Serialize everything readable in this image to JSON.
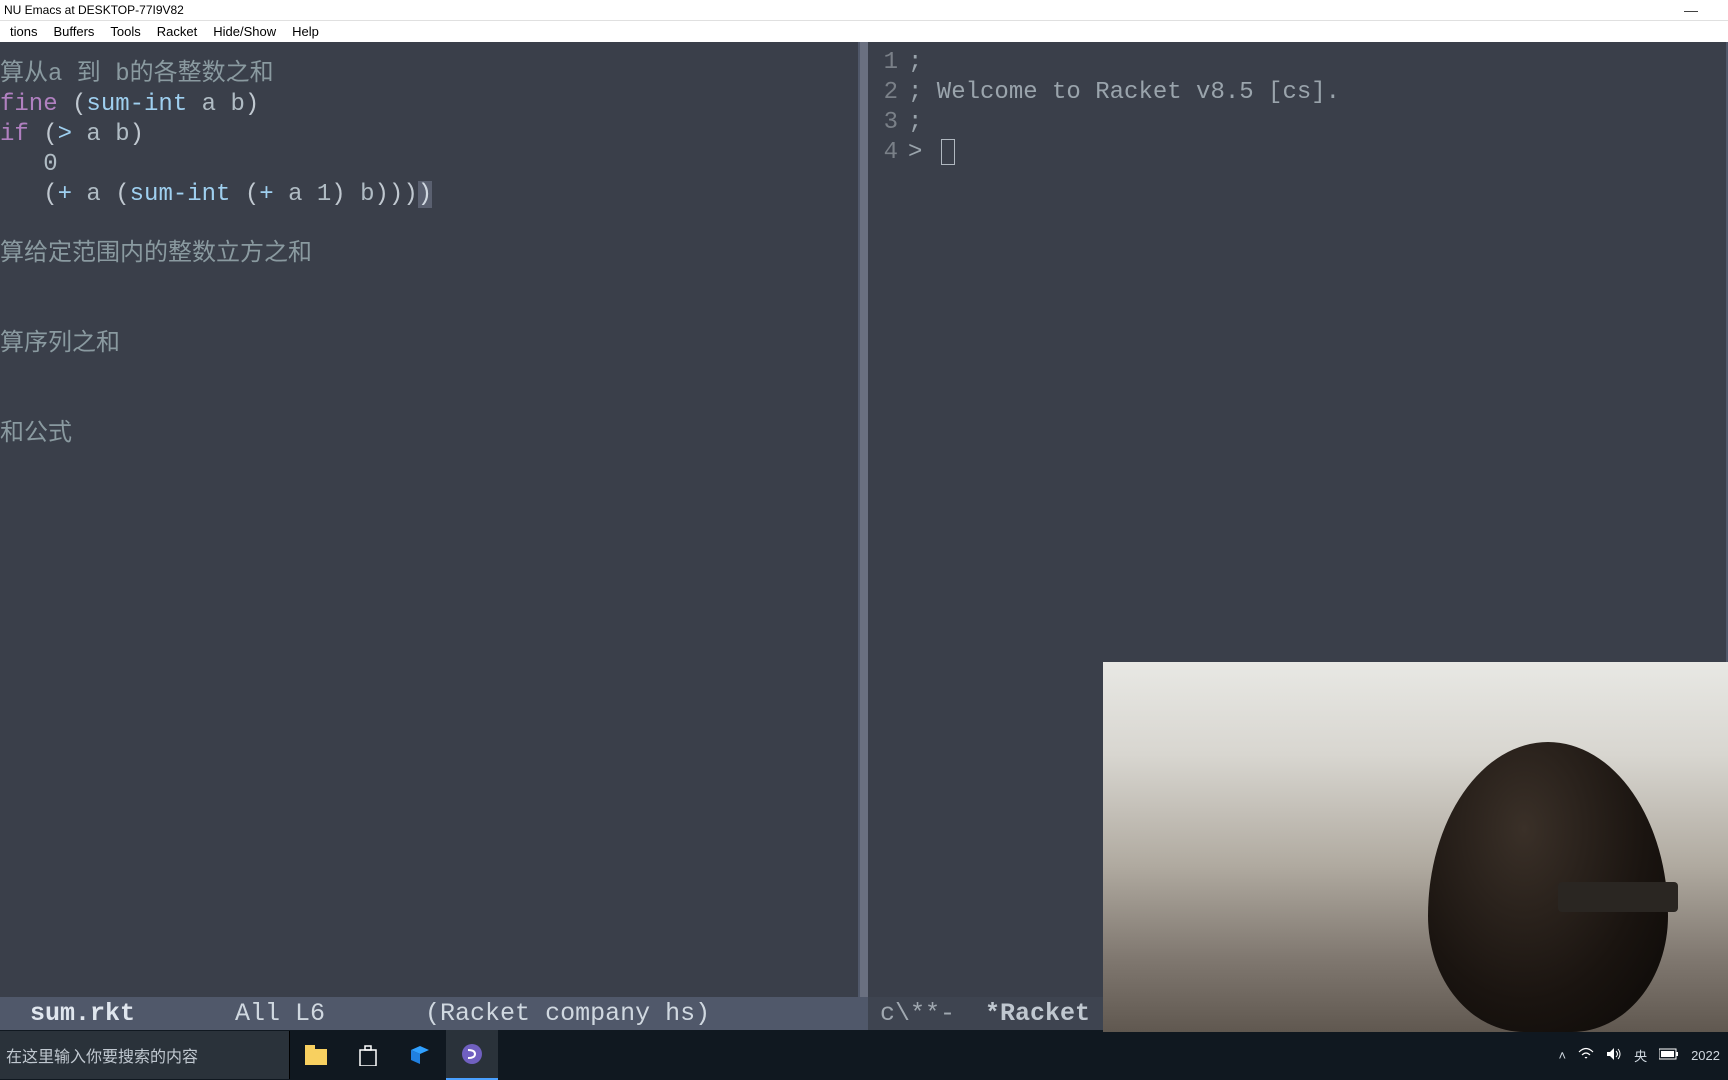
{
  "window": {
    "title": "NU Emacs at DESKTOP-77I9V82"
  },
  "menubar": [
    "tions",
    "Buffers",
    "Tools",
    "Racket",
    "Hide/Show",
    "Help"
  ],
  "editor_left": {
    "lines": [
      {
        "type": "comment",
        "text": "算从a 到 b的各整数之和"
      },
      {
        "type": "code",
        "segments": [
          {
            "c": "keyword",
            "t": "fine"
          },
          {
            "c": "paren",
            "t": " ("
          },
          {
            "c": "func",
            "t": "sum-int"
          },
          {
            "c": "text",
            "t": " a b"
          },
          {
            "c": "paren",
            "t": ")"
          }
        ]
      },
      {
        "type": "code",
        "segments": [
          {
            "c": "keyword",
            "t": "if"
          },
          {
            "c": "paren",
            "t": " ("
          },
          {
            "c": "func",
            "t": ">"
          },
          {
            "c": "text",
            "t": " a b"
          },
          {
            "c": "paren",
            "t": ")"
          }
        ]
      },
      {
        "type": "code",
        "segments": [
          {
            "c": "text",
            "t": "   0"
          }
        ]
      },
      {
        "type": "code",
        "segments": [
          {
            "c": "paren",
            "t": "   ("
          },
          {
            "c": "func",
            "t": "+"
          },
          {
            "c": "text",
            "t": " a "
          },
          {
            "c": "paren",
            "t": "("
          },
          {
            "c": "func",
            "t": "sum-int"
          },
          {
            "c": "paren",
            "t": " ("
          },
          {
            "c": "func",
            "t": "+"
          },
          {
            "c": "text",
            "t": " a 1"
          },
          {
            "c": "paren",
            "t": ")"
          },
          {
            "c": "text",
            "t": " b"
          },
          {
            "c": "paren",
            "t": ")))"
          },
          {
            "c": "hl",
            "t": ")"
          }
        ]
      },
      {
        "type": "blank"
      },
      {
        "type": "comment",
        "text": "算给定范围内的整数立方之和"
      },
      {
        "type": "blank"
      },
      {
        "type": "blank"
      },
      {
        "type": "comment",
        "text": "算序列之和"
      },
      {
        "type": "blank"
      },
      {
        "type": "blank"
      },
      {
        "type": "comment",
        "text": "和公式"
      }
    ]
  },
  "editor_right": {
    "gutters": [
      "1",
      "2",
      "3",
      "4"
    ],
    "lines": [
      {
        "t": ";",
        "prompt": false
      },
      {
        "t": "; Welcome to Racket v8.5 [cs].",
        "prompt": false
      },
      {
        "t": ";",
        "prompt": false
      },
      {
        "t": "> ",
        "prompt": true
      }
    ]
  },
  "modeline": {
    "left_buffer": "sum.rkt",
    "left_pos": "All L6",
    "left_mode": "(Racket company hs)",
    "right_flags": "c\\**-",
    "right_buffer": "*Racket"
  },
  "taskbar": {
    "search_placeholder": "在这里输入你要搜索的内容",
    "clock": "2022"
  },
  "tray_icons": {
    "chev": "chevron-up",
    "wifi": "wifi-icon",
    "vol": "volume-icon",
    "ime": "央"
  }
}
